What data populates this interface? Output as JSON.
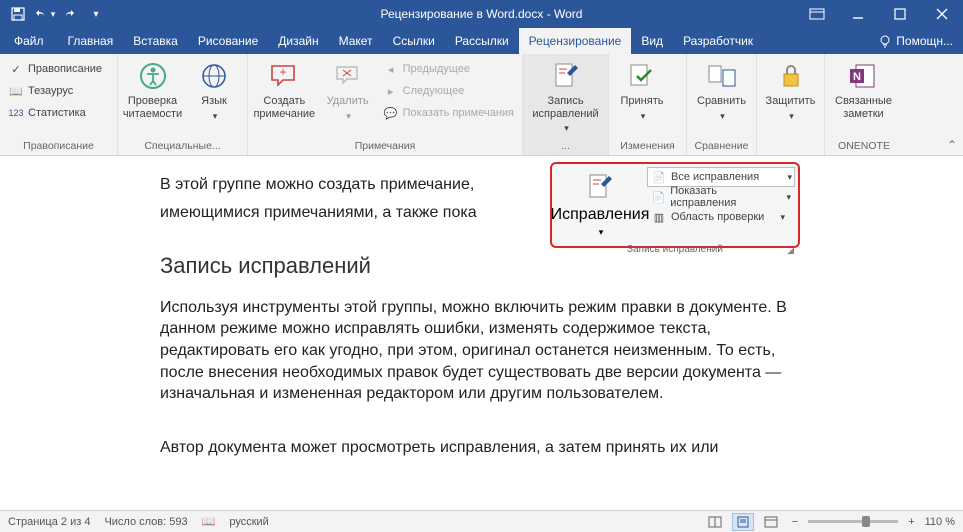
{
  "titlebar": {
    "title": "Рецензирование в Word.docx - Word"
  },
  "tabs": {
    "file": "Файл",
    "items": [
      "Главная",
      "Вставка",
      "Рисование",
      "Дизайн",
      "Макет",
      "Ссылки",
      "Рассылки",
      "Рецензирование",
      "Вид",
      "Разработчик"
    ],
    "active": "Рецензирование",
    "help": "Помощн..."
  },
  "ribbon": {
    "g1": {
      "spell": "Правописание",
      "thes": "Тезаурус",
      "stats": "Статистика",
      "label": "Правописание"
    },
    "g2": {
      "read": "Проверка\nчитаемости",
      "lang": "Язык",
      "label": "Специальные..."
    },
    "g3": {
      "new": "Создать\nпримечание",
      "del": "Удалить",
      "prev": "Предыдущее",
      "next": "Следующее",
      "show": "Показать примечания",
      "label": "Примечания"
    },
    "g4": {
      "track": "Запись\nисправлений",
      "label": "..."
    },
    "g5": {
      "accept": "Принять",
      "label": "Изменения"
    },
    "g6": {
      "compare": "Сравнить",
      "label": "Сравнение"
    },
    "g7": {
      "protect": "Защитить"
    },
    "g8": {
      "onenote": "Связанные\nзаметки",
      "label": "ONENOTE"
    }
  },
  "callout": {
    "btn": "Исправления",
    "combo": "Все исправления",
    "show": "Показать исправления",
    "area": "Область проверки",
    "label": "Запись исправлений"
  },
  "doc": {
    "p1": "В этой группе можно создать примечание,",
    "p2": "имеющимися примечаниями, а также пока",
    "h": "Запись исправлений",
    "p3": "Используя инструменты этой группы, можно включить режим правки в документе. В данном режиме можно исправлять ошибки, изменять содержимое текста, редактировать его как угодно, при этом, оригинал останется неизменным. То есть, после внесения необходимых правок будет существовать две версии документа — изначальная и измененная редактором или другим пользователем.",
    "p4": "Автор документа может просмотреть исправления, а затем принять их или"
  },
  "status": {
    "page": "Страница 2 из 4",
    "words": "Число слов: 593",
    "lang": "русский",
    "zoom": "110 %"
  }
}
